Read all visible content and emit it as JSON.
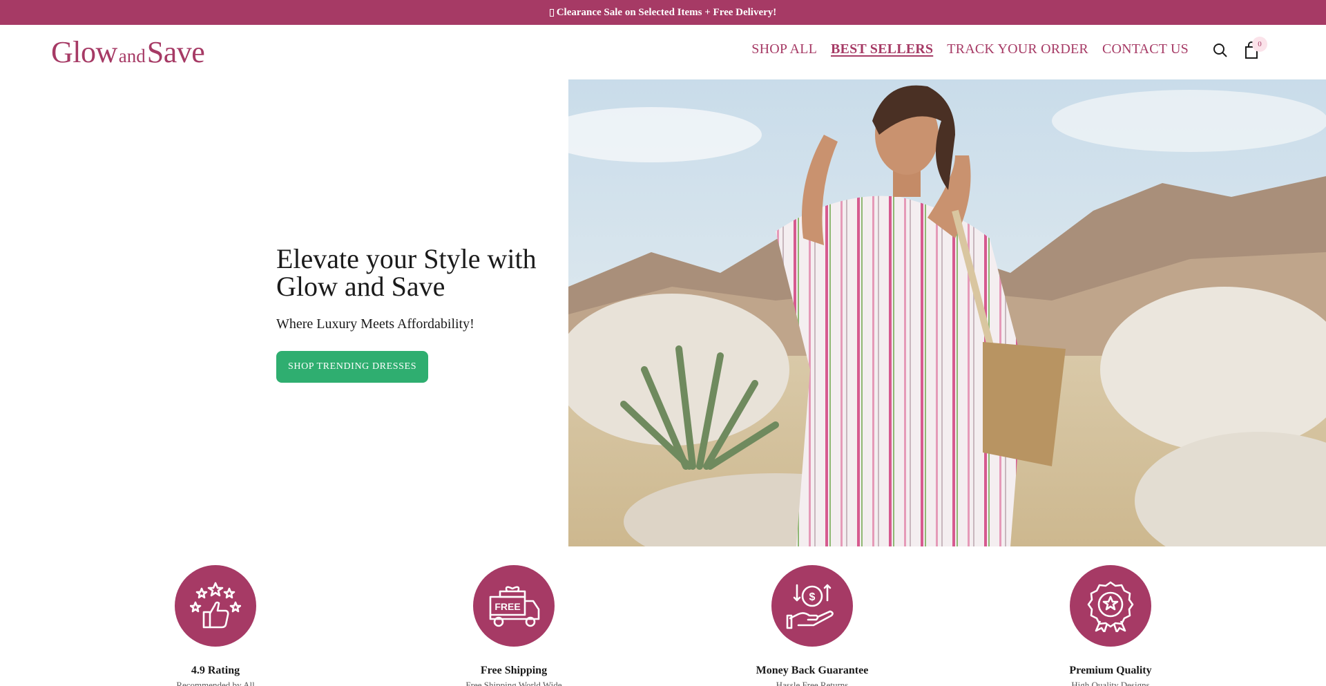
{
  "announcement": {
    "text": "Clearance Sale on Selected Items + Free Delivery!",
    "icon": "missing-glyph-icon"
  },
  "header": {
    "logo": {
      "part1": "Glow",
      "part2": "and",
      "part3": "Save"
    },
    "nav": [
      {
        "label": "SHOP ALL",
        "active": false
      },
      {
        "label": "BEST SELLERS",
        "active": true
      },
      {
        "label": "TRACK YOUR ORDER",
        "active": false
      },
      {
        "label": "CONTACT US",
        "active": false
      }
    ],
    "cart_count": "0",
    "icons": [
      "search-icon",
      "shopping-bag-icon"
    ]
  },
  "hero": {
    "title": "Elevate your Style with Glow and Save",
    "subtitle": "Where Luxury Meets Affordability!",
    "cta_label": "SHOP TRENDING DRESSES"
  },
  "features": [
    {
      "title": "4.9 Rating",
      "subtitle": "Recommended by All",
      "icon": "rating-thumbs-up-icon"
    },
    {
      "title": "Free Shipping",
      "subtitle": "Free Shipping World Wide",
      "icon": "free-delivery-truck-icon"
    },
    {
      "title": "Money Back Guarantee",
      "subtitle": "Hassle Free Returns",
      "icon": "money-back-hand-icon"
    },
    {
      "title": "Premium Quality",
      "subtitle": "High Quality Designs",
      "icon": "quality-badge-icon"
    }
  ],
  "colors": {
    "brand": "#a63a65",
    "cta": "#2fae70",
    "cart_badge_bg": "#fbe3ea",
    "text": "#1a1a1a"
  }
}
